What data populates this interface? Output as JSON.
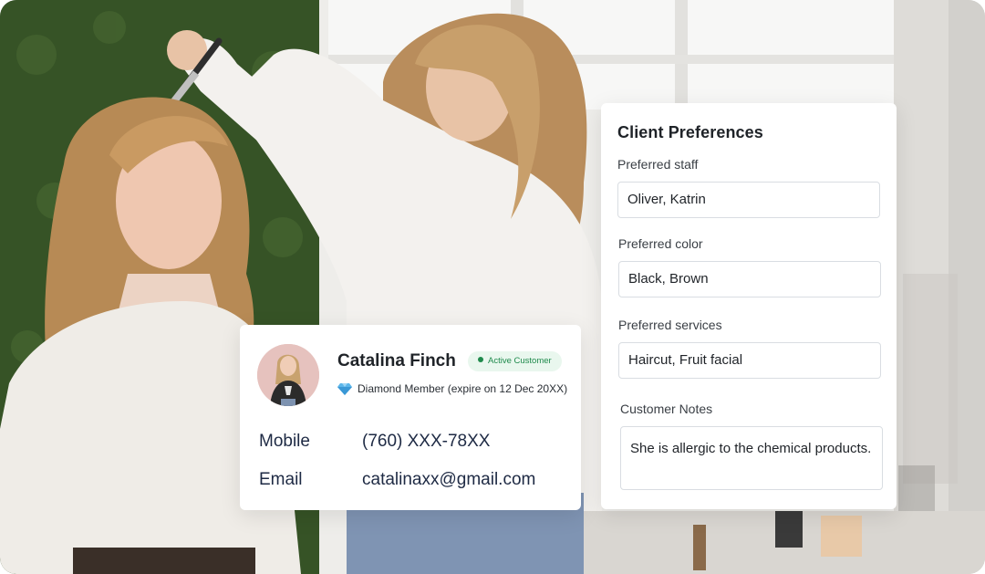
{
  "preferences": {
    "title": "Client Preferences",
    "staff_label": "Preferred staff",
    "staff_value": "Oliver, Katrin",
    "color_label": "Preferred color",
    "color_value": "Black, Brown",
    "services_label": "Preferred services",
    "services_value": "Haircut, Fruit facial",
    "notes_label": "Customer Notes",
    "notes_value": "She is allergic to the chemical products."
  },
  "customer": {
    "name": "Catalina Finch",
    "status_badge": "Active Customer",
    "membership": "Diamond Member (expire on 12 Dec 20XX)",
    "mobile_label": "Mobile",
    "mobile_value": "(760) XXX-78XX",
    "email_label": "Email",
    "email_value": "catalinaxx@gmail.com"
  },
  "icons": {
    "membership": "diamond-icon",
    "status": "status-dot-icon"
  },
  "colors": {
    "badge_bg": "#e9f7ee",
    "badge_text": "#1f8a4c",
    "diamond": "#4aa3e0",
    "text_primary": "#1f2328",
    "text_info": "#1e2a44"
  }
}
